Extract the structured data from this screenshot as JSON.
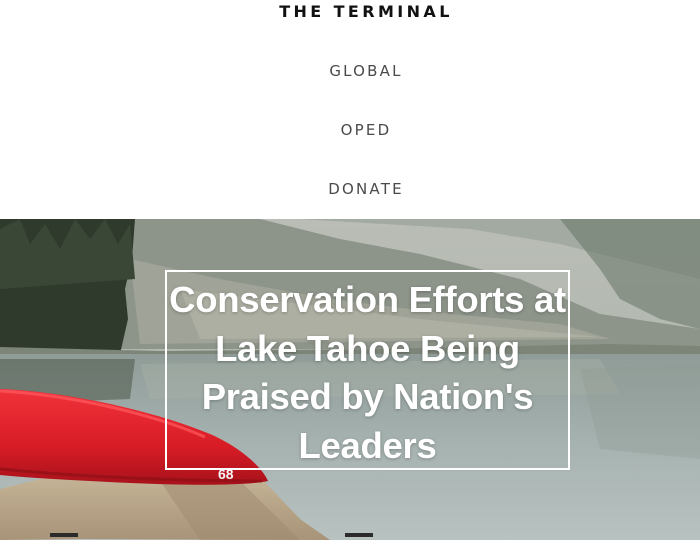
{
  "header": {
    "brand": "THE TERMINAL",
    "nav": [
      {
        "label": "GLOBAL"
      },
      {
        "label": "OPED"
      },
      {
        "label": "DONATE"
      }
    ]
  },
  "hero": {
    "headline": "Conservation Efforts at Lake Tahoe Being Praised by Nation's Leaders",
    "canoe_label": "68",
    "colors": {
      "headline_text": "#ffffff",
      "canoe": "#e0202a",
      "water": "#9aa7a4"
    }
  }
}
